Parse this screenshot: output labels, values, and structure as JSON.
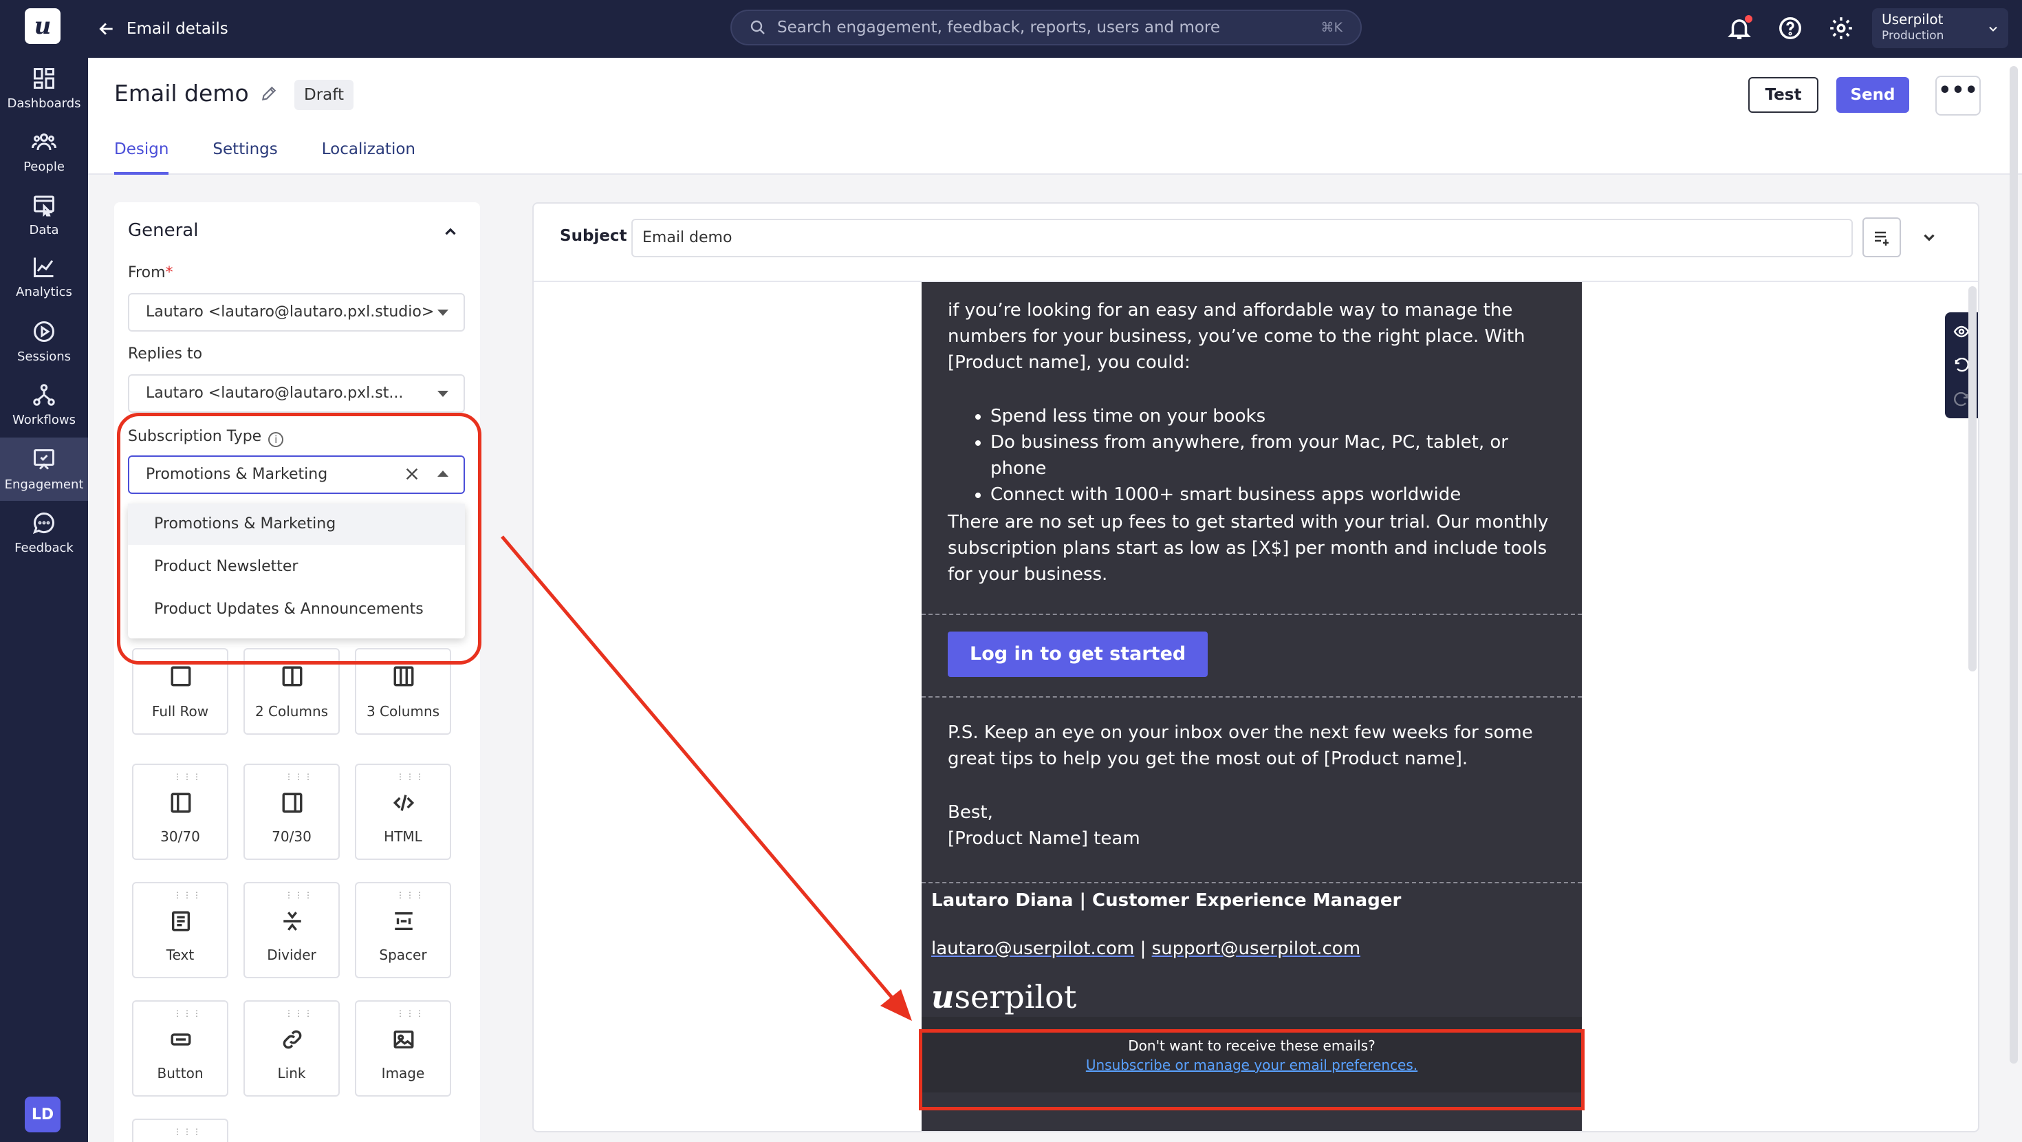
{
  "app": {
    "logo": "u",
    "breadcrumb": "Email details",
    "search_placeholder": "Search engagement, feedback, reports, users and more",
    "search_shortcut": "⌘K",
    "account_name": "Userpilot",
    "account_env": "Production",
    "user_initials": "LD"
  },
  "nav": {
    "items": [
      {
        "label": "Dashboards",
        "icon": "dashboard-icon"
      },
      {
        "label": "People",
        "icon": "people-icon"
      },
      {
        "label": "Data",
        "icon": "data-icon"
      },
      {
        "label": "Analytics",
        "icon": "analytics-icon"
      },
      {
        "label": "Sessions",
        "icon": "sessions-icon"
      },
      {
        "label": "Workflows",
        "icon": "workflows-icon"
      },
      {
        "label": "Engagement",
        "icon": "engagement-icon",
        "active": true
      },
      {
        "label": "Feedback",
        "icon": "feedback-icon"
      }
    ]
  },
  "header": {
    "title": "Email demo",
    "status": "Draft",
    "tabs": [
      {
        "label": "Design",
        "active": true
      },
      {
        "label": "Settings"
      },
      {
        "label": "Localization"
      }
    ],
    "test_label": "Test",
    "send_label": "Send",
    "more_label": "•••"
  },
  "panel": {
    "section_title": "General",
    "from_label": "From",
    "required_mark": "*",
    "from_value": "Lautaro <lautaro@lautaro.pxl.studio>",
    "replies_label": "Replies to",
    "replies_value": "Lautaro <lautaro@lautaro.pxl.st...",
    "subscription_label": "Subscription Type",
    "info_glyph": "i",
    "subscription_value": "Promotions & Marketing",
    "subscription_options": [
      "Promotions & Marketing",
      "Product Newsletter",
      "Product Updates & Announcements"
    ],
    "blocks": [
      {
        "label": "Full Row",
        "icon": "full-row-icon"
      },
      {
        "label": "2 Columns",
        "icon": "two-columns-icon"
      },
      {
        "label": "3 Columns",
        "icon": "three-columns-icon"
      },
      {
        "label": "30/70",
        "icon": "thirty-seventy-icon"
      },
      {
        "label": "70/30",
        "icon": "seventy-thirty-icon"
      },
      {
        "label": "HTML",
        "icon": "html-icon"
      },
      {
        "label": "Text",
        "icon": "text-icon"
      },
      {
        "label": "Divider",
        "icon": "divider-icon"
      },
      {
        "label": "Spacer",
        "icon": "spacer-icon"
      },
      {
        "label": "Button",
        "icon": "button-icon"
      },
      {
        "label": "Link",
        "icon": "link-icon"
      },
      {
        "label": "Image",
        "icon": "image-icon"
      }
    ]
  },
  "editor": {
    "subject_label": "Subject",
    "subject_value": "Email demo",
    "body": {
      "intro": "if you’re looking for an easy and affordable way to manage the numbers for your business, you’ve come to the right place. With [Product name], you could:",
      "bullets": [
        "Spend less time on your books",
        "Do business from anywhere, from your Mac, PC, tablet, or phone",
        "Connect with 1000+ smart business apps worldwide"
      ],
      "pricing": "There are no set up fees to get started with your trial. Our monthly subscription plans start as low as [X$] per month and include tools for your business.",
      "cta_label": "Log in to get started",
      "ps": "P.S. Keep an eye on your inbox over the next few weeks for some great tips to help you get the most out of [Product name].",
      "signoff": "Best,",
      "team": "[Product Name] team",
      "signature_name": "Lautaro Diana | Customer Experience Manager",
      "email_1": "lautaro@userpilot.com",
      "email_sep": " | ",
      "email_2": "support@userpilot.com",
      "logo_mark": "u",
      "logo_text": "serpilot",
      "unsubscribe_prompt": "Don't want to receive these emails?",
      "unsubscribe_link": "Unsubscribe or manage your email preferences."
    }
  },
  "colors": {
    "nav_bg": "#1e2340",
    "accent": "#5b5fe6",
    "email_bg": "#34343d",
    "annotation": "#e8321f"
  }
}
